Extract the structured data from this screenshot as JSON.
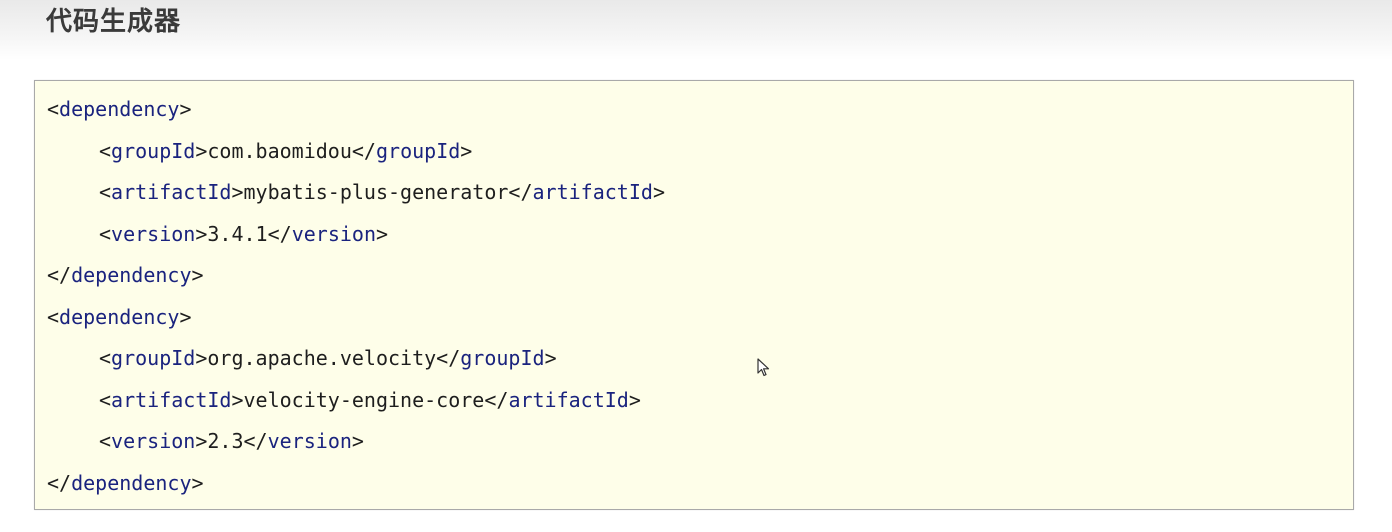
{
  "page": {
    "title": "代码生成器"
  },
  "code": {
    "lines": [
      {
        "indent": 0,
        "open": "<",
        "tag": "dependency",
        "close": ">",
        "text": "",
        "end_open": "",
        "end_tag": "",
        "end_close": ""
      },
      {
        "indent": 1,
        "open": "<",
        "tag": "groupId",
        "close": ">",
        "text": "com.baomidou",
        "end_open": "</",
        "end_tag": "groupId",
        "end_close": ">"
      },
      {
        "indent": 1,
        "open": "<",
        "tag": "artifactId",
        "close": ">",
        "text": "mybatis-plus-generator",
        "end_open": "</",
        "end_tag": "artifactId",
        "end_close": ">"
      },
      {
        "indent": 1,
        "open": "<",
        "tag": "version",
        "close": ">",
        "text": "3.4.1",
        "end_open": "</",
        "end_tag": "version",
        "end_close": ">"
      },
      {
        "indent": 0,
        "open": "</",
        "tag": "dependency",
        "close": ">",
        "text": "",
        "end_open": "",
        "end_tag": "",
        "end_close": ""
      },
      {
        "indent": 0,
        "open": "<",
        "tag": "dependency",
        "close": ">",
        "text": "",
        "end_open": "",
        "end_tag": "",
        "end_close": ""
      },
      {
        "indent": 1,
        "open": "<",
        "tag": "groupId",
        "close": ">",
        "text": "org.apache.velocity",
        "end_open": "</",
        "end_tag": "groupId",
        "end_close": ">"
      },
      {
        "indent": 1,
        "open": "<",
        "tag": "artifactId",
        "close": ">",
        "text": "velocity-engine-core",
        "end_open": "</",
        "end_tag": "artifactId",
        "end_close": ">"
      },
      {
        "indent": 1,
        "open": "<",
        "tag": "version",
        "close": ">",
        "text": "2.3",
        "end_open": "</",
        "end_tag": "version",
        "end_close": ">"
      },
      {
        "indent": 0,
        "open": "</",
        "tag": "dependency",
        "close": ">",
        "text": "",
        "end_open": "",
        "end_tag": "",
        "end_close": ""
      }
    ]
  },
  "icons": {
    "cursor": "mouse-pointer-icon"
  },
  "colors": {
    "tag": "#1a237e",
    "text": "#1e1e1e",
    "panel_background": "#fefee9",
    "panel_border": "#a9a9a9"
  }
}
